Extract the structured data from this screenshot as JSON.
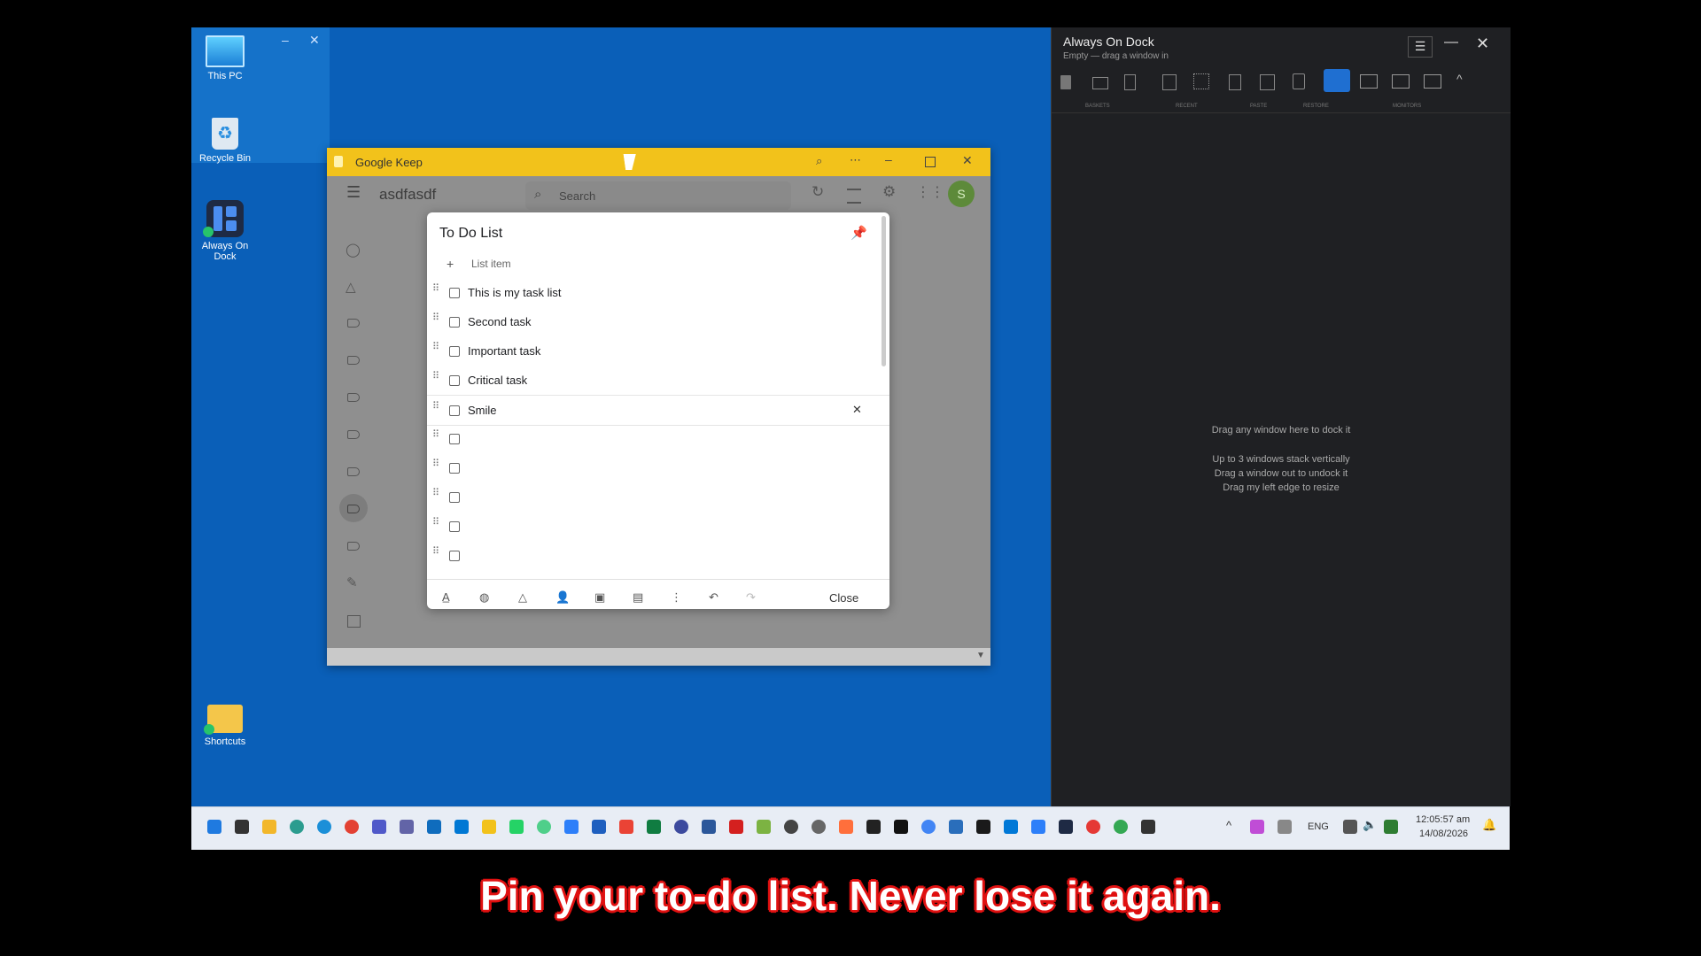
{
  "desktop": {
    "icons": [
      {
        "label": "This PC"
      },
      {
        "label": "Recycle Bin"
      },
      {
        "label": "Always On Dock"
      },
      {
        "label": "Shortcuts"
      }
    ]
  },
  "dock": {
    "title": "Always On Dock",
    "subtitle": "Empty — drag a window in",
    "group_labels": [
      "BASKETS",
      "RECENT",
      "PASTE",
      "RESTORE",
      "MONITORS"
    ],
    "hint_main": "Drag any window here to dock it",
    "hint_1": "Up to 3 windows stack vertically",
    "hint_2": "Drag a window out to undock it",
    "hint_3": "Drag my left edge to resize"
  },
  "keep": {
    "window_title": "Google Keep",
    "header_title": "asdfasdf",
    "search_placeholder": "Search",
    "avatar_letter": "S",
    "note": {
      "title": "To Do List",
      "add_item": "List item",
      "items": [
        {
          "text": "This is my task list"
        },
        {
          "text": "Second task"
        },
        {
          "text": "Important task"
        },
        {
          "text": "Critical task"
        },
        {
          "text": "Smile"
        },
        {
          "text": ""
        },
        {
          "text": ""
        },
        {
          "text": ""
        },
        {
          "text": ""
        },
        {
          "text": ""
        }
      ],
      "close_label": "Close"
    }
  },
  "taskbar": {
    "lang": "ENG",
    "time": "12:05:57 am",
    "date": "14/08/2026"
  },
  "caption": "Pin your to-do list. Never lose it again.",
  "colors": {
    "desktop_blue": "#0a5fb8",
    "keep_yellow": "#f2c21b",
    "dock_bg": "#1f2023",
    "caption_outline": "#e01010"
  }
}
